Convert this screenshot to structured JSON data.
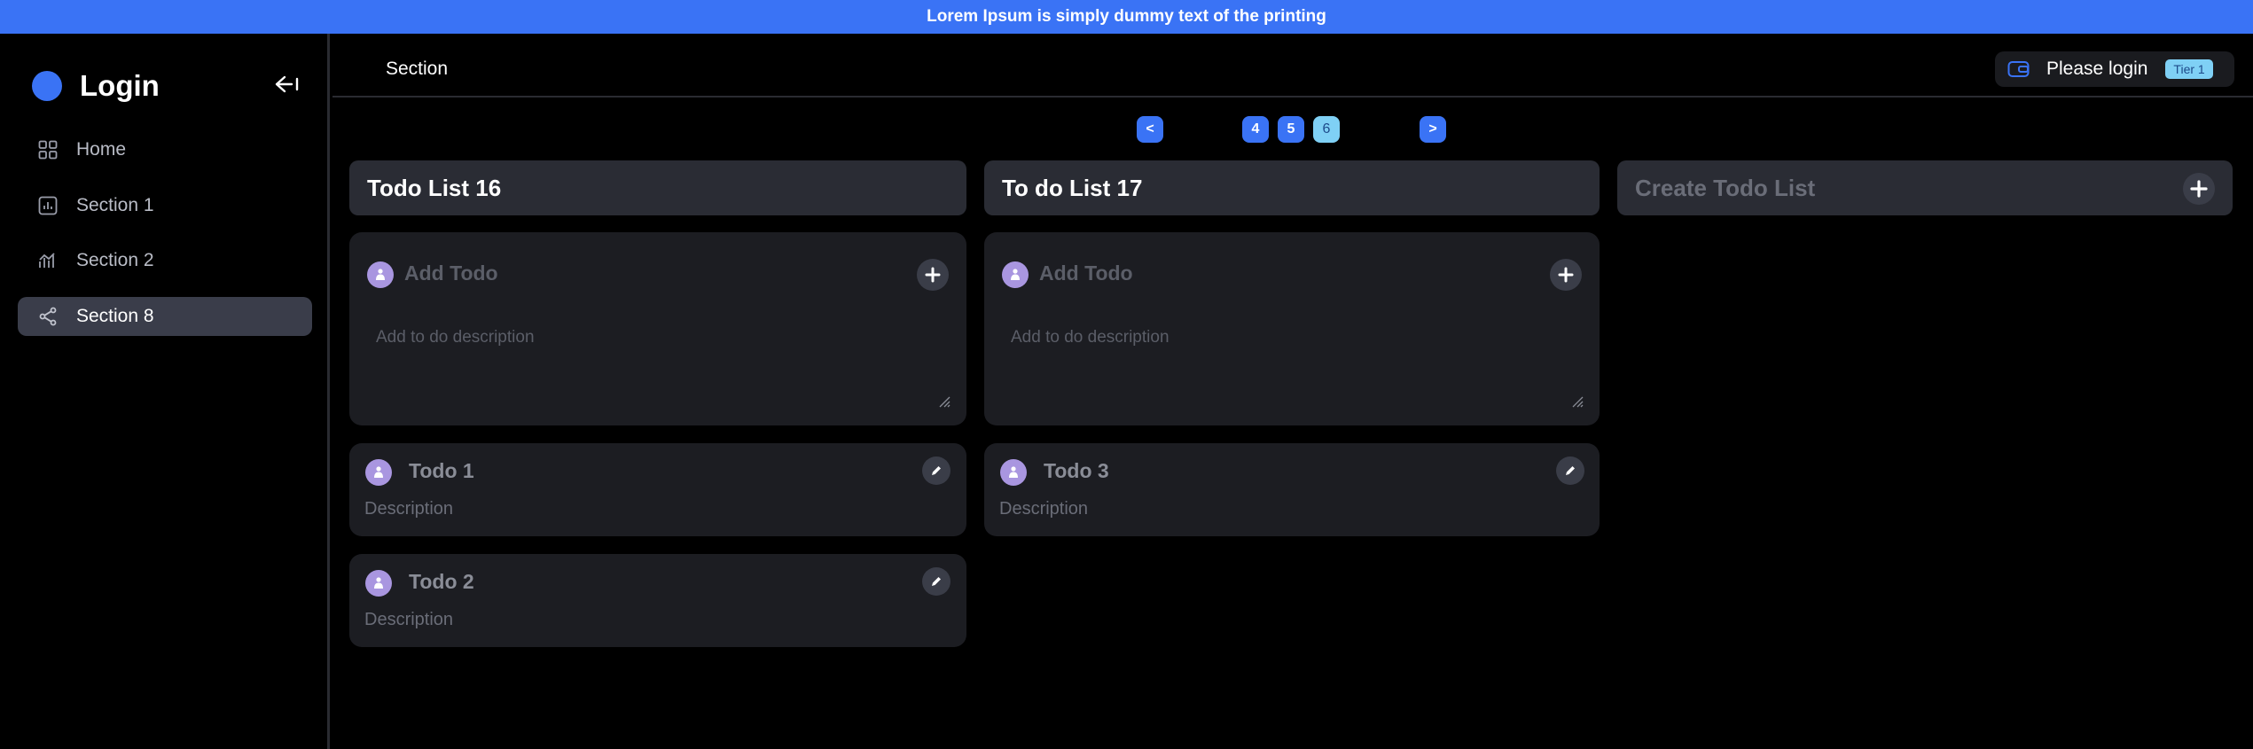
{
  "banner": {
    "text": "Lorem Ipsum is simply dummy text of the printing"
  },
  "sidebar": {
    "logo_text": "Login",
    "collapse_icon": "arrow-left-collapse-icon",
    "items": [
      {
        "label": "Home",
        "icon": "grid-icon",
        "active": false
      },
      {
        "label": "Section 1",
        "icon": "bar-chart-icon",
        "active": false
      },
      {
        "label": "Section 2",
        "icon": "activity-icon",
        "active": false
      },
      {
        "label": "Section 8",
        "icon": "share-icon",
        "active": true
      }
    ]
  },
  "header": {
    "title": "Section",
    "login_text": "Please login",
    "tier": "Tier 1",
    "wallet_icon": "wallet-icon"
  },
  "pagination": {
    "prev": "<",
    "next": ">",
    "pages": [
      "4",
      "5",
      "6"
    ],
    "current": "6"
  },
  "lists": [
    {
      "title": "Todo List 16",
      "add_title_placeholder": "Add Todo",
      "add_desc_placeholder": "Add to do description",
      "todos": [
        {
          "title": "Todo 1",
          "description": "Description"
        },
        {
          "title": "Todo 2",
          "description": "Description"
        }
      ]
    },
    {
      "title": "To do List 17",
      "add_title_placeholder": "Add Todo",
      "add_desc_placeholder": "Add to do description",
      "todos": [
        {
          "title": "Todo 3",
          "description": "Description"
        }
      ]
    }
  ],
  "create_list": {
    "label": "Create Todo List"
  },
  "colors": {
    "accent": "#3a73f5",
    "tier_badge": "#7fd0f5",
    "avatar": "#a996e0",
    "card": "#1c1d22",
    "list_header": "#2a2c34"
  }
}
